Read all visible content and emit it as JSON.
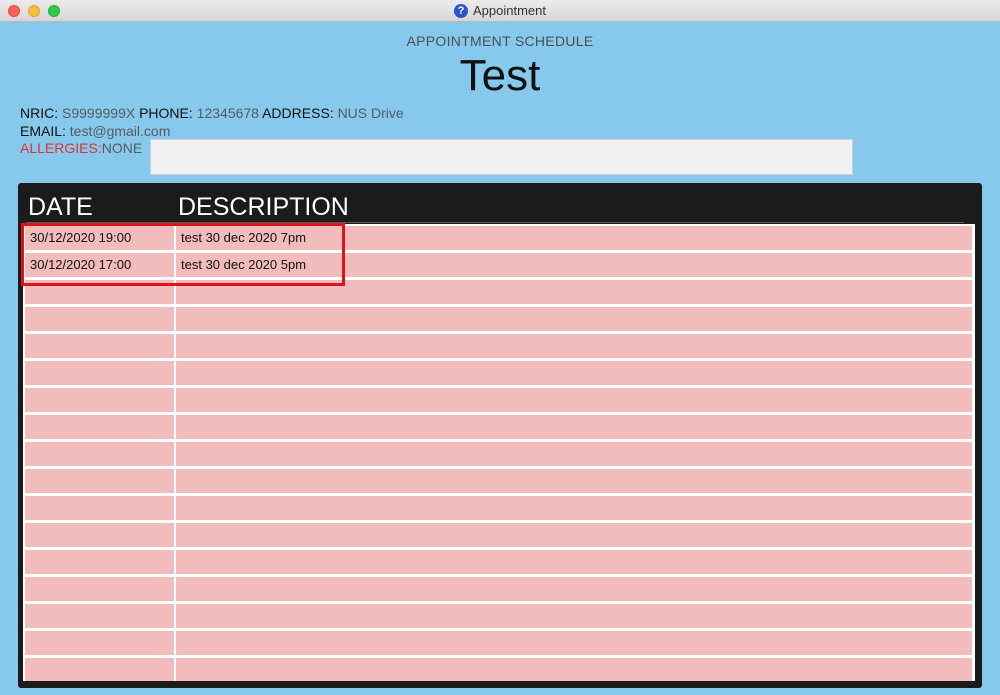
{
  "window": {
    "title": "Appointment",
    "app_icon": "?"
  },
  "header": {
    "subtitle": "APPOINTMENT SCHEDULE",
    "name": "Test"
  },
  "patient": {
    "nric_label": "NRIC:",
    "nric": "S9999999X",
    "phone_label": "PHONE:",
    "phone": "12345678",
    "address_label": "ADDRESS:",
    "address": "NUS Drive",
    "email_label": "EMAIL:",
    "email": "test@gmail.com",
    "allergies_label": "ALLERGIES:",
    "allergies": "NONE"
  },
  "table": {
    "headers": {
      "date": "DATE",
      "description": "DESCRIPTION"
    },
    "rows": [
      {
        "date": "30/12/2020 19:00",
        "description": "test 30 dec 2020 7pm"
      },
      {
        "date": "30/12/2020 17:00",
        "description": "test 30 dec 2020 5pm"
      }
    ],
    "empty_rows": 15
  },
  "colors": {
    "background": "#87c9ec",
    "row": "#f2bcbc",
    "panel": "#1b1b1b",
    "highlight": "#e0121a",
    "allergy": "#e03030"
  }
}
